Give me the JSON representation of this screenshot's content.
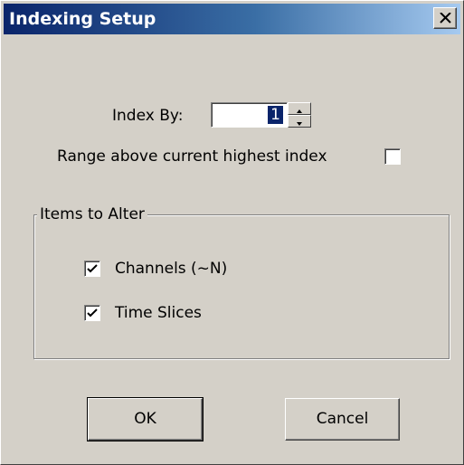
{
  "window": {
    "title": "Indexing Setup",
    "close_icon": "close-icon"
  },
  "index_by": {
    "label": "Index By:",
    "value": "1"
  },
  "range_option": {
    "label": "Range above current highest index",
    "checked": false
  },
  "items_group": {
    "title": "Items to Alter",
    "items": [
      {
        "label": "Channels (~N)",
        "checked": true
      },
      {
        "label": "Time Slices",
        "checked": true
      }
    ]
  },
  "buttons": {
    "ok_label": "OK",
    "cancel_label": "Cancel"
  },
  "colors": {
    "title_bar_start": "#0a246a",
    "title_bar_end": "#a6caf0",
    "dialog_background": "#d4d0c8",
    "selection": "#0a246a"
  }
}
